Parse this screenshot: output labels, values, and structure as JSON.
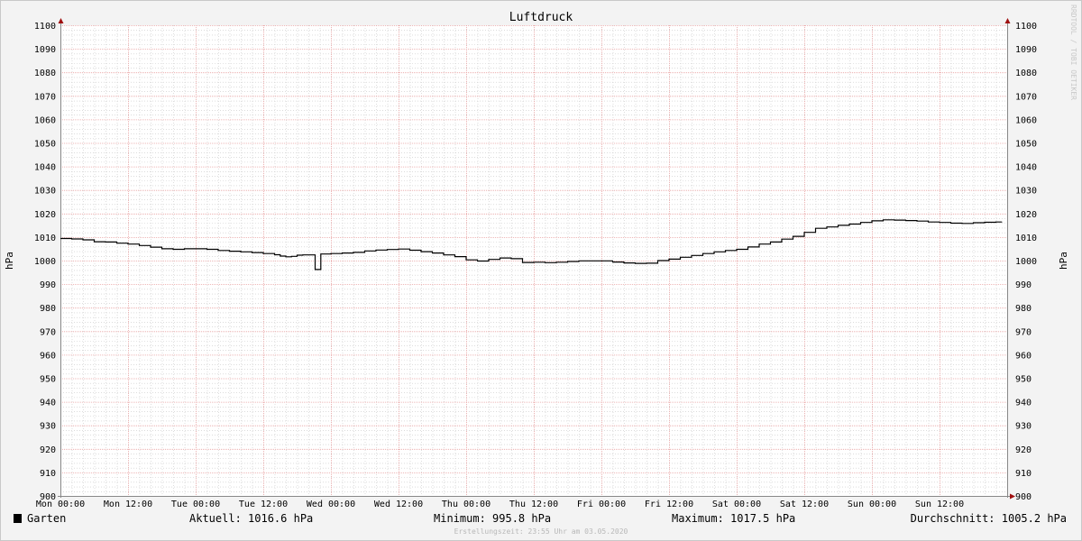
{
  "chart_data": {
    "type": "line",
    "title": "Luftdruck",
    "ylabel": "hPa",
    "ylim": [
      900,
      1100
    ],
    "y_ticks": [
      1100,
      1090,
      1080,
      1070,
      1060,
      1050,
      1040,
      1030,
      1020,
      1010,
      1000,
      990,
      980,
      970,
      960,
      950,
      940,
      930,
      920,
      910,
      900
    ],
    "x_ticks": [
      "Mon 00:00",
      "Mon 12:00",
      "Tue 00:00",
      "Tue 12:00",
      "Wed 00:00",
      "Wed 12:00",
      "Thu 00:00",
      "Thu 12:00",
      "Fri 00:00",
      "Fri 12:00",
      "Sat 00:00",
      "Sat 12:00",
      "Sun 00:00",
      "Sun 12:00"
    ],
    "xlim_hours": [
      0,
      168
    ],
    "grid": true,
    "series": [
      {
        "name": "Garten",
        "color": "#000000",
        "points": [
          [
            0,
            1009.4
          ],
          [
            2,
            1009.2
          ],
          [
            4,
            1008.8
          ],
          [
            6,
            1008.0
          ],
          [
            8,
            1007.9
          ],
          [
            10,
            1007.4
          ],
          [
            12,
            1007.0
          ],
          [
            14,
            1006.4
          ],
          [
            16,
            1005.7
          ],
          [
            18,
            1005.0
          ],
          [
            20,
            1004.8
          ],
          [
            22,
            1005.0
          ],
          [
            24,
            1005.0
          ],
          [
            26,
            1004.8
          ],
          [
            28,
            1004.3
          ],
          [
            30,
            1004.0
          ],
          [
            32,
            1003.7
          ],
          [
            34,
            1003.4
          ],
          [
            36,
            1003.0
          ],
          [
            38,
            1002.5
          ],
          [
            39,
            1001.9
          ],
          [
            40,
            1001.6
          ],
          [
            41,
            1001.8
          ],
          [
            42,
            1002.3
          ],
          [
            43,
            1002.4
          ],
          [
            45,
            1002.4
          ],
          [
            45.2,
            996.2
          ],
          [
            46,
            996.2
          ],
          [
            46.2,
            1002.8
          ],
          [
            48,
            1003.0
          ],
          [
            50,
            1003.2
          ],
          [
            52,
            1003.5
          ],
          [
            54,
            1004.1
          ],
          [
            56,
            1004.5
          ],
          [
            58,
            1004.7
          ],
          [
            60,
            1004.9
          ],
          [
            61,
            1004.9
          ],
          [
            62,
            1004.4
          ],
          [
            64,
            1003.8
          ],
          [
            66,
            1003.2
          ],
          [
            68,
            1002.4
          ],
          [
            70,
            1001.7
          ],
          [
            72,
            1000.3
          ],
          [
            74,
            999.8
          ],
          [
            76,
            1000.5
          ],
          [
            78,
            1001.1
          ],
          [
            80,
            1000.8
          ],
          [
            82,
            999.2
          ],
          [
            84,
            999.3
          ],
          [
            86,
            999.1
          ],
          [
            88,
            999.3
          ],
          [
            90,
            999.6
          ],
          [
            92,
            999.9
          ],
          [
            94,
            999.9
          ],
          [
            96,
            999.9
          ],
          [
            98,
            999.4
          ],
          [
            100,
            999.0
          ],
          [
            102,
            998.8
          ],
          [
            104,
            998.9
          ],
          [
            106,
            1000.0
          ],
          [
            108,
            1000.6
          ],
          [
            110,
            1001.4
          ],
          [
            112,
            1002.2
          ],
          [
            114,
            1003.0
          ],
          [
            116,
            1003.7
          ],
          [
            118,
            1004.3
          ],
          [
            120,
            1004.8
          ],
          [
            122,
            1005.8
          ],
          [
            124,
            1007.0
          ],
          [
            126,
            1007.9
          ],
          [
            128,
            1009.1
          ],
          [
            130,
            1010.3
          ],
          [
            132,
            1012.0
          ],
          [
            134,
            1013.7
          ],
          [
            136,
            1014.3
          ],
          [
            138,
            1015.0
          ],
          [
            140,
            1015.5
          ],
          [
            142,
            1016.2
          ],
          [
            144,
            1016.9
          ],
          [
            146,
            1017.3
          ],
          [
            148,
            1017.2
          ],
          [
            150,
            1017.0
          ],
          [
            152,
            1016.8
          ],
          [
            154,
            1016.4
          ],
          [
            156,
            1016.2
          ],
          [
            158,
            1015.9
          ],
          [
            160,
            1015.8
          ],
          [
            162,
            1016.1
          ],
          [
            164,
            1016.3
          ],
          [
            166,
            1016.4
          ],
          [
            167,
            1016.6
          ]
        ]
      }
    ]
  },
  "legend": {
    "series_label": "Garten",
    "swatch_color": "#000000",
    "current": "Aktuell: 1016.6 hPa",
    "minimum": "Minimum: 995.8 hPa",
    "maximum": "Maximum: 1017.5 hPa",
    "average": "Durchschnitt: 1005.2 hPa"
  },
  "footer": "Erstellungszeit: 23:55 Uhr am 03.05.2020",
  "watermark": "RRDTOOL / TOBI OETIKER",
  "colors": {
    "background": "#f3f3f3",
    "canvas": "#ffffff",
    "major_grid": "#e8a0a0",
    "minor_grid": "#c8c8c8",
    "axis": "#888888",
    "arrow": "#a01010"
  }
}
